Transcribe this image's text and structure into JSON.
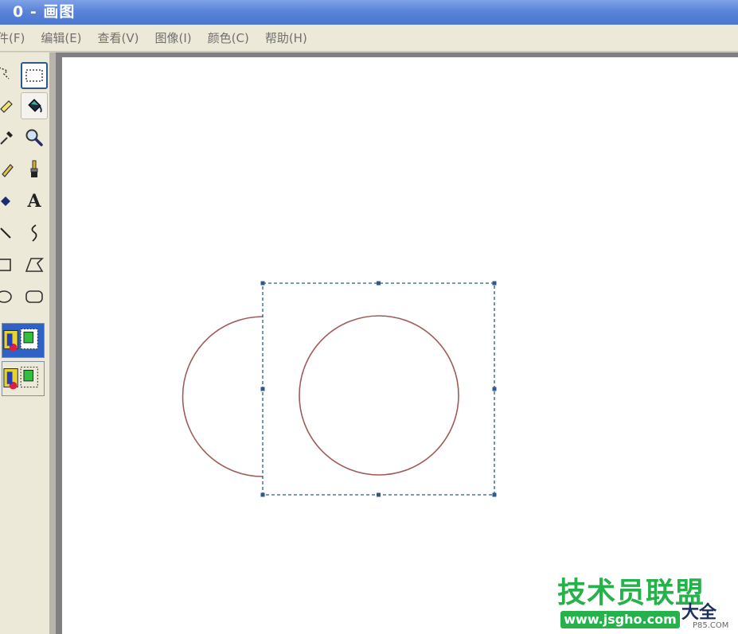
{
  "window": {
    "title": "0 - 画图"
  },
  "menu": [
    {
      "label": "文件(F)",
      "visible_label": "件(F)"
    },
    {
      "label": "编辑(E)"
    },
    {
      "label": "查看(V)"
    },
    {
      "label": "图像(I)"
    },
    {
      "label": "颜色(C)"
    },
    {
      "label": "帮助(H)"
    }
  ],
  "toolbox": {
    "tools": [
      {
        "name": "free-form-select",
        "icon": "star-select-icon"
      },
      {
        "name": "rectangle-select",
        "icon": "rect-select-icon",
        "state": "selected"
      },
      {
        "name": "eraser",
        "icon": "eraser-icon"
      },
      {
        "name": "fill",
        "icon": "paint-bucket-icon",
        "state": "pressed"
      },
      {
        "name": "pick-color",
        "icon": "eyedropper-icon"
      },
      {
        "name": "magnifier",
        "icon": "magnifier-icon"
      },
      {
        "name": "pencil",
        "icon": "pencil-icon"
      },
      {
        "name": "brush",
        "icon": "brush-icon"
      },
      {
        "name": "airbrush",
        "icon": "airbrush-icon"
      },
      {
        "name": "text",
        "icon": "text-icon",
        "glyph": "A"
      },
      {
        "name": "line",
        "icon": "line-icon"
      },
      {
        "name": "curve",
        "icon": "curve-icon"
      },
      {
        "name": "rectangle",
        "icon": "rectangle-icon"
      },
      {
        "name": "polygon",
        "icon": "polygon-icon"
      },
      {
        "name": "ellipse",
        "icon": "ellipse-icon"
      },
      {
        "name": "rounded-rectangle",
        "icon": "rounded-rectangle-icon"
      }
    ],
    "options": [
      {
        "name": "opaque-selection",
        "state": "selected"
      },
      {
        "name": "transparent-selection",
        "state": "normal"
      }
    ]
  },
  "canvas": {
    "background": "#ffffff",
    "shape_color": "#a05a5a",
    "selection_color": "#2d5a8e"
  },
  "watermark": {
    "main": "技术员联盟",
    "url": "www.jsgho.com",
    "side": "大全",
    "small": "P85.COM"
  }
}
